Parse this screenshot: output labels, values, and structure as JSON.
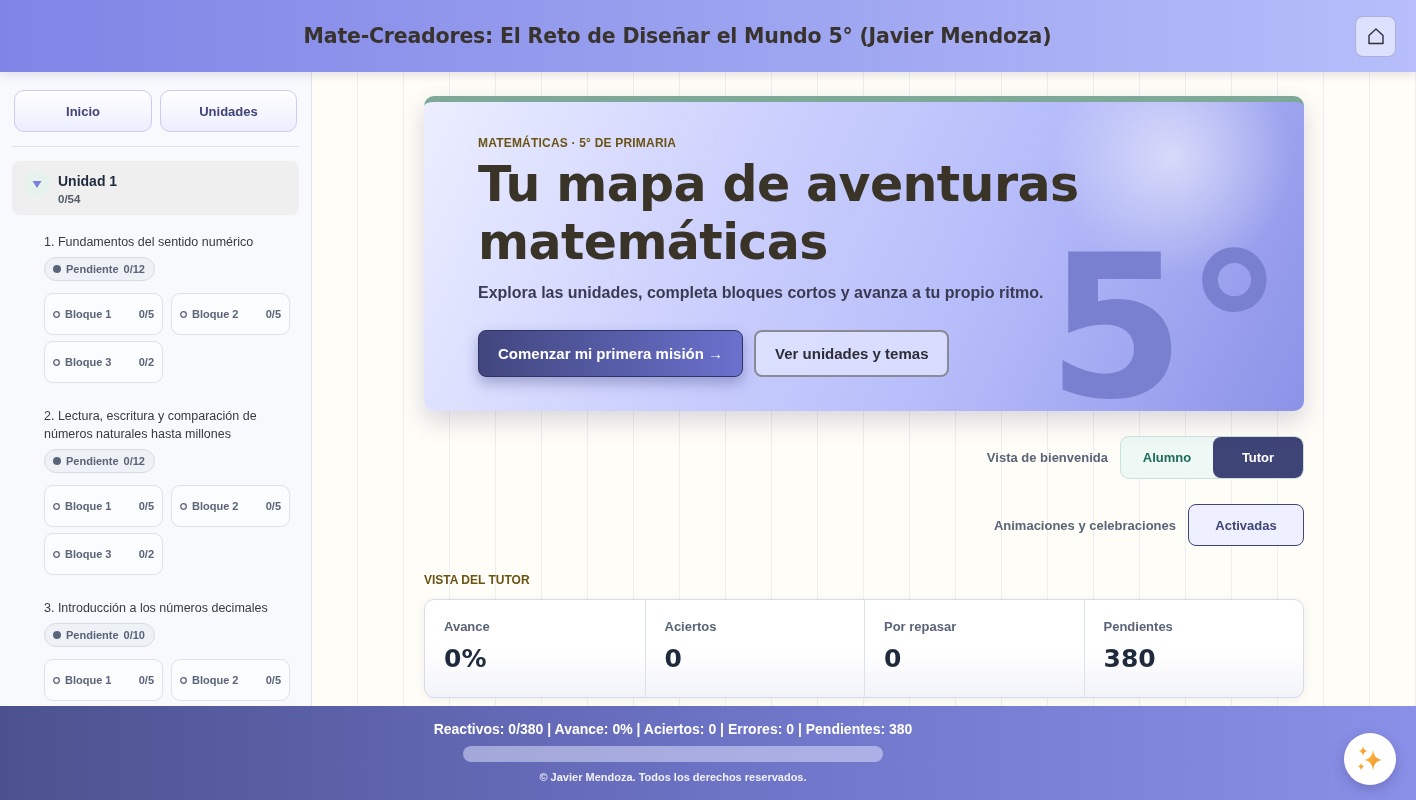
{
  "header": {
    "title": "Mate-Creadores: El Reto de Diseñar el Mundo 5° (Javier Mendoza)"
  },
  "sidebar": {
    "nav": [
      {
        "label": "Inicio"
      },
      {
        "label": "Unidades"
      }
    ],
    "units": [
      {
        "name": "Unidad 1",
        "progress": "0/54",
        "expanded": true,
        "topics": [
          {
            "title": "1. Fundamentos del sentido numérico",
            "status": "Pendiente",
            "count": "0/12",
            "blocks": [
              {
                "label": "Bloque 1",
                "count": "0/5"
              },
              {
                "label": "Bloque 2",
                "count": "0/5"
              },
              {
                "label": "Bloque 3",
                "count": "0/2"
              }
            ]
          },
          {
            "title": "2. Lectura, escritura y comparación de números naturales hasta millones",
            "status": "Pendiente",
            "count": "0/12",
            "blocks": [
              {
                "label": "Bloque 1",
                "count": "0/5"
              },
              {
                "label": "Bloque 2",
                "count": "0/5"
              },
              {
                "label": "Bloque 3",
                "count": "0/2"
              }
            ]
          },
          {
            "title": "3. Introducción a los números decimales",
            "status": "Pendiente",
            "count": "0/10",
            "blocks": [
              {
                "label": "Bloque 1",
                "count": "0/5"
              },
              {
                "label": "Bloque 2",
                "count": "0/5"
              }
            ]
          }
        ]
      }
    ]
  },
  "hero": {
    "eyebrow": "MATEMÁTICAS · 5° DE PRIMARIA",
    "title": "Tu mapa de aventuras matemáticas",
    "subtitle": "Explora las unidades, completa bloques cortos y avanza a tu propio ritmo.",
    "watermark": "5°",
    "buttons": [
      {
        "label": "Comenzar mi primera misión →",
        "kind": "primary"
      },
      {
        "label": "Ver unidades y temas",
        "kind": "secondary"
      }
    ]
  },
  "welcome_view": {
    "label": "Vista de bienvenida",
    "options": [
      {
        "label": "Alumno",
        "selected": false
      },
      {
        "label": "Tutor",
        "selected": true
      }
    ]
  },
  "animations": {
    "label": "Animaciones y celebraciones",
    "button": "Activadas",
    "on": true
  },
  "tutor_view": {
    "heading": "VISTA DEL TUTOR",
    "stats": [
      {
        "label": "Avance",
        "value": "0%"
      },
      {
        "label": "Aciertos",
        "value": "0"
      },
      {
        "label": "Por repasar",
        "value": "0"
      },
      {
        "label": "Pendientes",
        "value": "380"
      }
    ]
  },
  "footer": {
    "summary": "Reactivos: 0/380 | Avance: 0% | Aciertos: 0 | Errores: 0 | Pendientes: 380",
    "progress": {
      "level": 0
    },
    "copyright": "© Javier Mendoza. Todos los derechos reservados."
  }
}
